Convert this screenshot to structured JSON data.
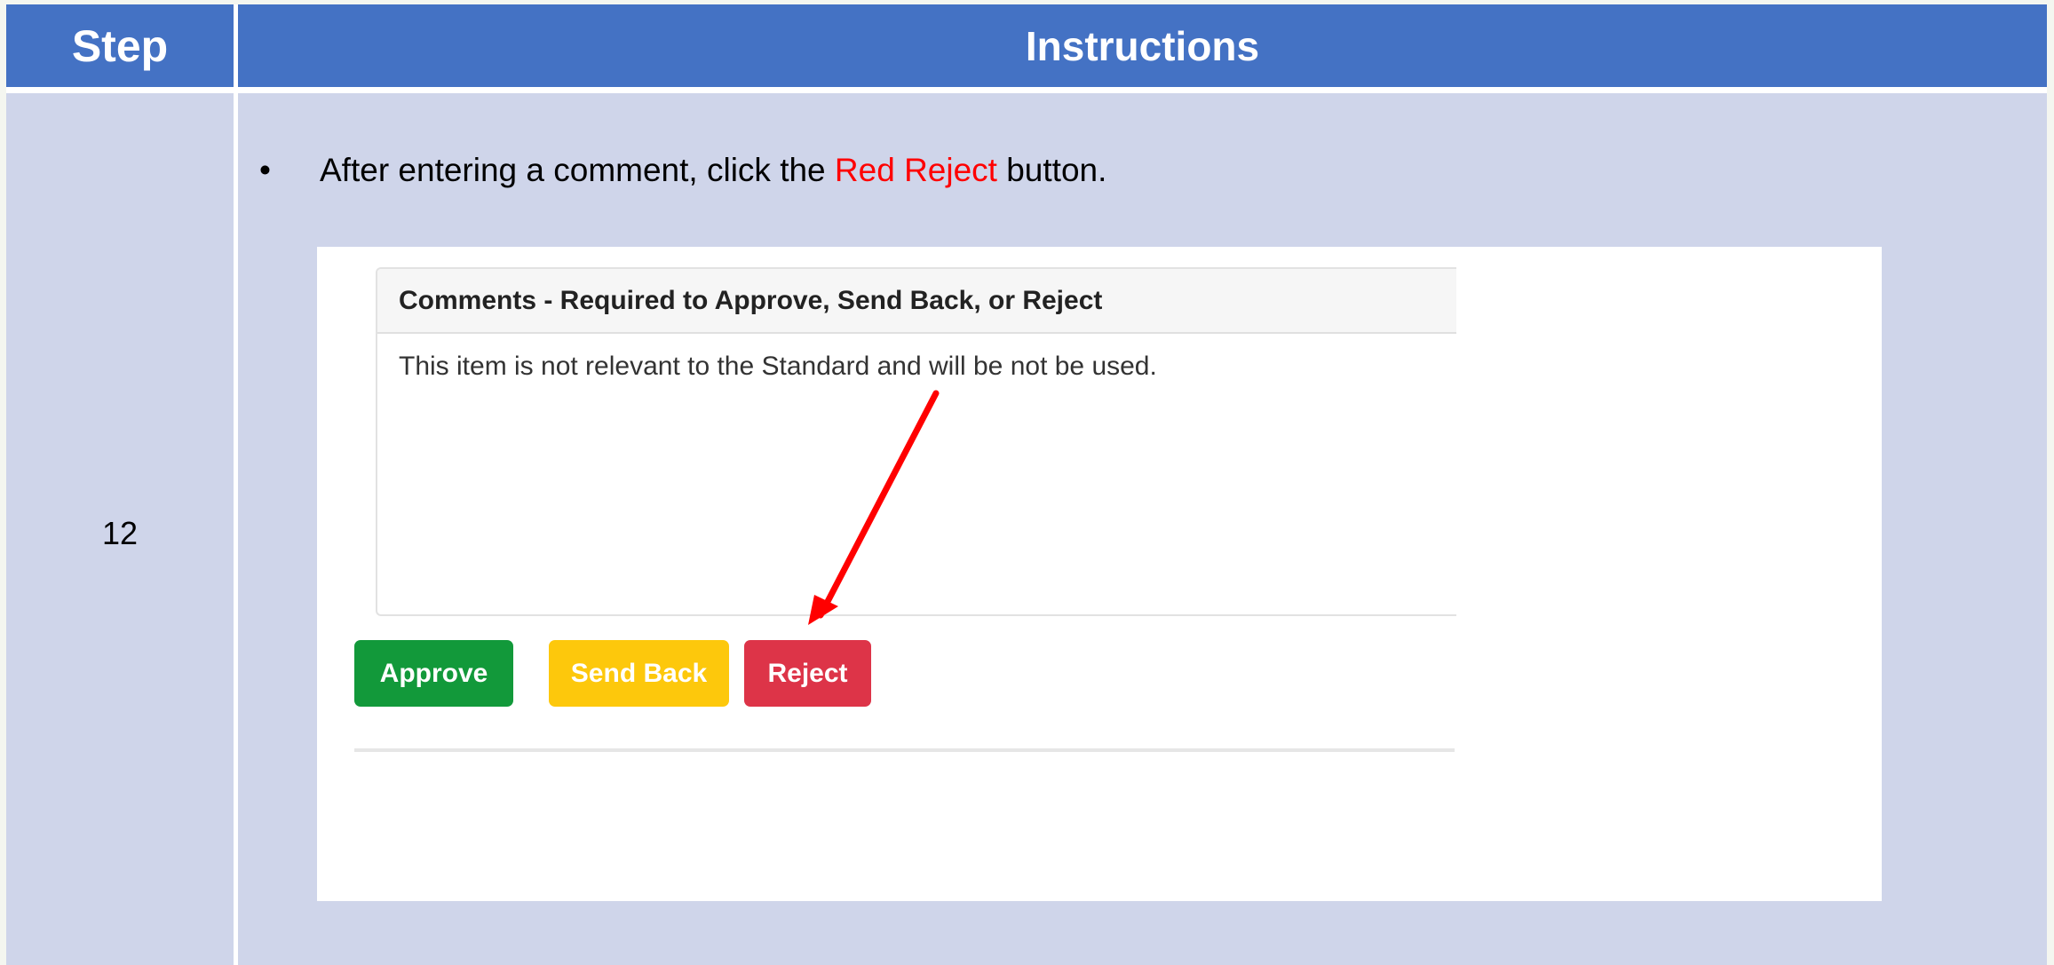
{
  "header": {
    "step": "Step",
    "instructions": "Instructions"
  },
  "row": {
    "step_number": "12",
    "bullet": "•",
    "instruction_before": "After entering a comment, click the ",
    "instruction_highlight": "Red Reject",
    "instruction_after": " button."
  },
  "screenshot": {
    "panel_title": "Comments - Required to Approve, Send Back, or Reject",
    "comment_text": "This item is not relevant to the Standard and will be not be used.",
    "buttons": {
      "approve": "Approve",
      "send_back": "Send Back",
      "reject": "Reject"
    }
  },
  "colors": {
    "header_bg": "#4472c4",
    "cell_bg": "#cfd5ea",
    "highlight": "#ff0000",
    "approve": "#12993a",
    "send_back": "#fdc80c",
    "reject": "#dd3448",
    "arrow": "#ff0000"
  }
}
